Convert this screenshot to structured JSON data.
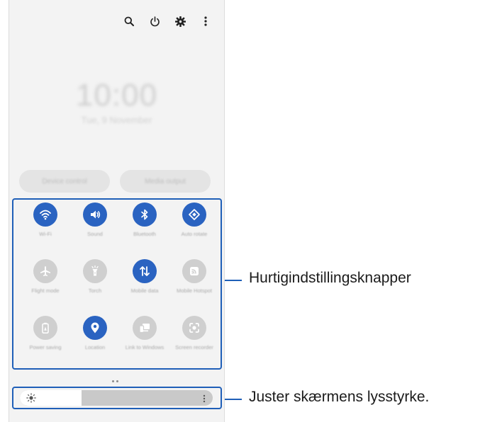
{
  "topbar": {
    "icons": [
      "search-icon",
      "power-icon",
      "settings-icon",
      "more-options-icon"
    ]
  },
  "clock": {
    "time": "10:00",
    "date": "Tue, 9 November"
  },
  "buttons": {
    "device_control": "Device control",
    "media_output": "Media output"
  },
  "quick_settings": [
    {
      "label": "Wi-Fi",
      "icon": "wifi-icon",
      "state": "on"
    },
    {
      "label": "Sound",
      "icon": "sound-icon",
      "state": "on"
    },
    {
      "label": "Bluetooth",
      "icon": "bluetooth-icon",
      "state": "on"
    },
    {
      "label": "Auto rotate",
      "icon": "auto-rotate-icon",
      "state": "on"
    },
    {
      "label": "Flight mode",
      "icon": "flight-mode-icon",
      "state": "off"
    },
    {
      "label": "Torch",
      "icon": "torch-icon",
      "state": "off"
    },
    {
      "label": "Mobile data",
      "icon": "mobile-data-icon",
      "state": "on"
    },
    {
      "label": "Mobile Hotspot",
      "icon": "hotspot-icon",
      "state": "off"
    },
    {
      "label": "Power saving",
      "icon": "power-saving-icon",
      "state": "off"
    },
    {
      "label": "Location",
      "icon": "location-icon",
      "state": "on"
    },
    {
      "label": "Link to Windows",
      "icon": "link-to-windows-icon",
      "state": "off"
    },
    {
      "label": "Screen recorder",
      "icon": "screen-recorder-icon",
      "state": "off"
    }
  ],
  "page_indicator": {
    "count": 2
  },
  "brightness": {
    "level": 0.32
  },
  "callouts": {
    "quick_settings": "Hurtigindstillingsknapper",
    "brightness": "Juster skærmens lysstyrke."
  },
  "colors": {
    "accent": "#2a63c1",
    "highlight": "#1f5fb8",
    "tile_off": "#cfcfcf",
    "panel": "#f3f3f3"
  }
}
